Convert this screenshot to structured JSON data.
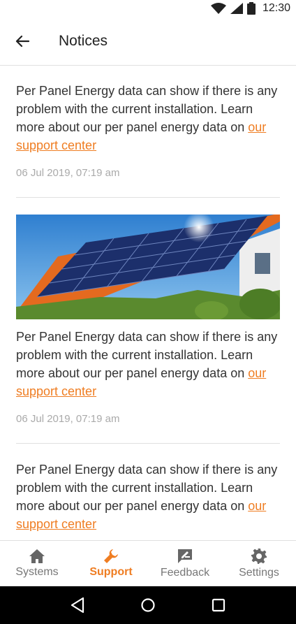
{
  "status_bar": {
    "time": "12:30",
    "icons": [
      "wifi-icon",
      "signal-icon",
      "battery-icon"
    ]
  },
  "header": {
    "title": "Notices",
    "back_icon": "arrow-left-icon"
  },
  "notices": [
    {
      "text": "Per Panel Energy data can  show if there is any problem with the current installation. Learn more about our per panel energy data on ",
      "link": "our support center",
      "date": "06 Jul 2019, 07:19 am",
      "has_image": false
    },
    {
      "text": "Per Panel Energy data can  show if there is any problem with the current installation. Learn more about our per panel energy data on ",
      "link": "our support center",
      "date": "06 Jul 2019, 07:19 am",
      "has_image": true,
      "image": "solar-roof-house-photo"
    },
    {
      "text": "Per Panel Energy data can  show if there is any problem with the current installation. Learn more about our per panel energy data on ",
      "link": "our support center",
      "date": "",
      "has_image": false
    }
  ],
  "bottom_nav": {
    "items": [
      {
        "label": "Systems",
        "icon": "home-icon",
        "active": false
      },
      {
        "label": "Support",
        "icon": "wrench-icon",
        "active": true
      },
      {
        "label": "Feedback",
        "icon": "feedback-icon",
        "active": false
      },
      {
        "label": "Settings",
        "icon": "gear-icon",
        "active": false
      }
    ]
  },
  "colors": {
    "accent": "#ef7d22",
    "text": "#333333",
    "muted": "#aaaaaa",
    "divider": "#e0e0e0"
  },
  "system_nav": {
    "buttons": [
      "back-triangle-icon",
      "home-circle-icon",
      "recents-square-icon"
    ]
  }
}
